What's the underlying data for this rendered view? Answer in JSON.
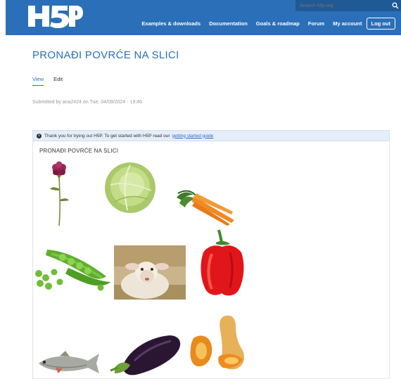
{
  "header": {
    "logo_text": "H5P",
    "search_placeholder": "Search h5p.org",
    "nav": [
      "Examples & downloads",
      "Documentation",
      "Goals & roadmap",
      "Forum",
      "My account"
    ],
    "logout_label": "Log out"
  },
  "page": {
    "title": "PRONAĐI POVRĆE NA SLICI",
    "tabs": [
      "View",
      "Edit"
    ],
    "submitted": "Submitted by ana2424 on Tue, 04/09/2024 - 19:46"
  },
  "notice": {
    "text": "Thank you for trying out H5P. To get started with H5P read our",
    "link": "getting started guide"
  },
  "activity": {
    "title": "PRONAĐI POVRĆE NA SLICI",
    "items": [
      "carnation",
      "cabbage",
      "carrots",
      "peas",
      "sheep",
      "red-pepper",
      "fish",
      "eggplant",
      "butternut-squash"
    ]
  },
  "colors": {
    "brand": "#2b6fb8",
    "notice_bg": "#e5eef8"
  }
}
